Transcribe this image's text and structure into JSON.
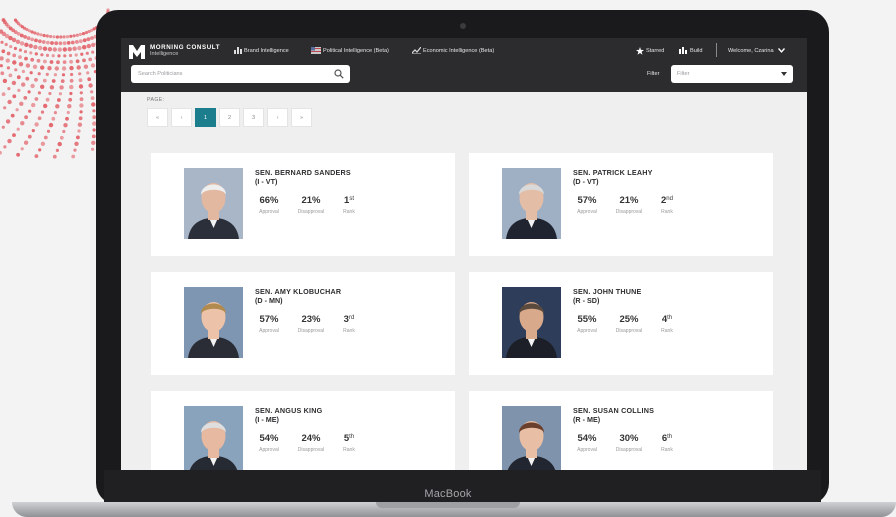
{
  "device": {
    "label": "MacBook"
  },
  "navbar": {
    "logo_title": "MORNING CONSULT",
    "logo_subtitle": "Intelligence",
    "links": [
      {
        "label": "Brand Intelligence",
        "icon": "bar-chart-icon"
      },
      {
        "label": "Political Intelligence (Beta)",
        "icon": "flag-icon"
      },
      {
        "label": "Economic Intelligence (Beta)",
        "icon": "line-chart-icon"
      }
    ],
    "starred_label": "Starred",
    "build_label": "Build",
    "welcome_label": "Welcome, Czarina"
  },
  "search": {
    "placeholder": "Search Politicians"
  },
  "filter": {
    "label": "Filter",
    "placeholder": "Filter"
  },
  "pagination": {
    "label": "PAGE:",
    "items": [
      "«",
      "‹",
      "1",
      "2",
      "3",
      "›",
      "»"
    ],
    "active": "1"
  },
  "labels": {
    "approval": "Approval",
    "disapproval": "Disapproval",
    "rank": "Rank"
  },
  "politicians": [
    {
      "name": "SEN. BERNARD SANDERS",
      "party": "(I - VT)",
      "approval": "66%",
      "disapproval": "21%",
      "rank": "1",
      "rank_suffix": "st",
      "photo": {
        "bg": "#a9b6c8",
        "skin": "#e2b8a0",
        "hair": "#eeeeee",
        "suit": "#2b2f3a"
      }
    },
    {
      "name": "SEN. PATRICK LEAHY",
      "party": "(D - VT)",
      "approval": "57%",
      "disapproval": "21%",
      "rank": "2",
      "rank_suffix": "nd",
      "photo": {
        "bg": "#9fb0c4",
        "skin": "#e3bda6",
        "hair": "#d9d9d9",
        "suit": "#1f2430"
      }
    },
    {
      "name": "SEN. AMY KLOBUCHAR",
      "party": "(D - MN)",
      "approval": "57%",
      "disapproval": "23%",
      "rank": "3",
      "rank_suffix": "rd",
      "photo": {
        "bg": "#7e96b1",
        "skin": "#ecc3a8",
        "hair": "#b08a4f",
        "suit": "#2a2d36"
      }
    },
    {
      "name": "SEN. JOHN THUNE",
      "party": "(R - SD)",
      "approval": "55%",
      "disapproval": "25%",
      "rank": "4",
      "rank_suffix": "th",
      "photo": {
        "bg": "#2e3e5a",
        "skin": "#d9a98c",
        "hair": "#5a4a3e",
        "suit": "#1c1f28"
      }
    },
    {
      "name": "SEN. ANGUS KING",
      "party": "(I - ME)",
      "approval": "54%",
      "disapproval": "24%",
      "rank": "5",
      "rank_suffix": "th",
      "photo": {
        "bg": "#8aa3bd",
        "skin": "#e6b9a0",
        "hair": "#dedede",
        "suit": "#262a33"
      }
    },
    {
      "name": "SEN. SUSAN COLLINS",
      "party": "(R - ME)",
      "approval": "54%",
      "disapproval": "30%",
      "rank": "6",
      "rank_suffix": "th",
      "photo": {
        "bg": "#7f93ac",
        "skin": "#e8bea4",
        "hair": "#6a3f2c",
        "suit": "#222630"
      }
    }
  ]
}
